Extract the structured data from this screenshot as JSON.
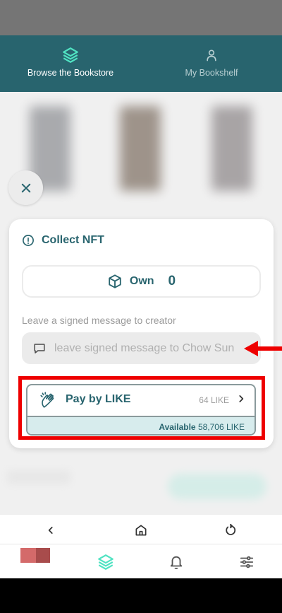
{
  "tabs": {
    "browse": {
      "label": "Browse the Bookstore",
      "icon": "layers-icon",
      "active": true
    },
    "shelf": {
      "label": "My Bookshelf",
      "icon": "user-icon",
      "active": false
    }
  },
  "collect": {
    "title": "Collect NFT",
    "own_label": "Own",
    "own_count": "0",
    "message_label": "Leave a signed message to creator",
    "message_placeholder": "leave signed message to Chow Sun",
    "pay": {
      "label": "Pay by LIKE",
      "price": "64 LIKE",
      "available_label": "Available",
      "available_value": "58,706 LIKE"
    }
  },
  "colors": {
    "brand": "#28646e",
    "accent": "#50e3c2",
    "highlight": "#ee0000",
    "available_bg": "#d7eced"
  }
}
